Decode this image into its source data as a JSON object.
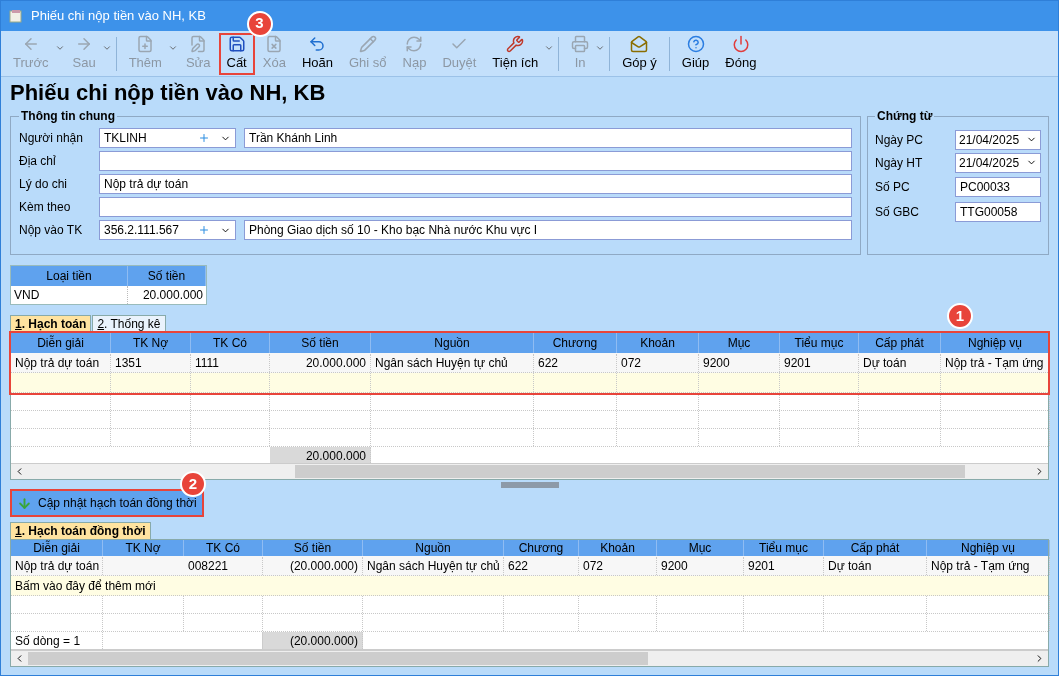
{
  "window": {
    "title": "Phiếu chi nộp tiền vào NH, KB"
  },
  "toolbar": [
    {
      "kind": "button",
      "label": "Trước",
      "disabled": true,
      "dropdown": true
    },
    {
      "kind": "button",
      "label": "Sau",
      "disabled": true,
      "dropdown": true
    },
    {
      "kind": "separator"
    },
    {
      "kind": "button",
      "label": "Thêm",
      "disabled": true,
      "dropdown": true
    },
    {
      "kind": "button",
      "label": "Sửa",
      "disabled": true,
      "dropdown": false
    },
    {
      "kind": "button",
      "label": "Cất",
      "disabled": false,
      "dropdown": false,
      "callout": "3"
    },
    {
      "kind": "button",
      "label": "Xóa",
      "disabled": true,
      "dropdown": false
    },
    {
      "kind": "button",
      "label": "Hoãn",
      "disabled": false,
      "dropdown": false
    },
    {
      "kind": "button",
      "label": "Ghi sổ",
      "disabled": true,
      "dropdown": false
    },
    {
      "kind": "button",
      "label": "Nạp",
      "disabled": true,
      "dropdown": false
    },
    {
      "kind": "button",
      "label": "Duyệt",
      "disabled": true,
      "dropdown": false
    },
    {
      "kind": "button",
      "label": "Tiện ích",
      "disabled": false,
      "dropdown": true
    },
    {
      "kind": "separator"
    },
    {
      "kind": "button",
      "label": "In",
      "disabled": true,
      "dropdown": true
    },
    {
      "kind": "separator"
    },
    {
      "kind": "button",
      "label": "Góp ý",
      "disabled": false,
      "dropdown": false
    },
    {
      "kind": "separator"
    },
    {
      "kind": "button",
      "label": "Giúp",
      "disabled": false,
      "dropdown": false
    },
    {
      "kind": "button",
      "label": "Đóng",
      "disabled": false,
      "dropdown": false
    }
  ],
  "heading": "Phiếu chi nộp tiền vào NH, KB",
  "general_info": {
    "title": "Thông tin chung",
    "fields": [
      {
        "kind": "lookup",
        "label": "Người nhận",
        "value": "TKLINH",
        "detail": "Trần Khánh Linh"
      },
      {
        "kind": "text",
        "label": "Địa chỉ"
      },
      {
        "kind": "text",
        "label": "Lý do chi",
        "value": "Nộp trả dự toán"
      },
      {
        "kind": "text",
        "label": "Kèm theo"
      },
      {
        "kind": "lookup",
        "label": "Nộp vào TK",
        "value": "356.2.111.567",
        "detail": "Phòng Giao dịch số 10 - Kho bạc Nhà nước Khu vực I"
      }
    ]
  },
  "voucher": {
    "title": "Chứng từ",
    "fields": [
      {
        "kind": "date",
        "label": "Ngày PC",
        "value": "21/04/2025"
      },
      {
        "kind": "date",
        "label": "Ngày HT",
        "value": "21/04/2025"
      },
      {
        "kind": "text",
        "label": "Số PC",
        "value": "PC00033"
      },
      {
        "kind": "text",
        "label": "Số GBC",
        "value": "TTG00058"
      }
    ]
  },
  "currency_table": {
    "columns": [
      "Loại tiền",
      "Số tiền"
    ],
    "rows": [
      [
        "VND",
        "20.000.000"
      ]
    ]
  },
  "tabs": [
    {
      "hotkey": "1",
      "label": ". Hạch toán",
      "selected": true
    },
    {
      "hotkey": "2",
      "label": ". Thống kê",
      "selected": false
    }
  ],
  "entries_grid": {
    "callout": "1",
    "columns": [
      "Diễn giải",
      "TK Nợ",
      "TK Có",
      "Số tiền",
      "Nguồn",
      "Chương",
      "Khoản",
      "Mục",
      "Tiểu mục",
      "Cấp phát",
      "Nghiệp vụ"
    ],
    "rows": [
      [
        "Nộp trả dự toán",
        "1351",
        "1111",
        "20.000.000",
        "Ngân sách Huyện tự chủ",
        "622",
        "072",
        "9200",
        "9201",
        "Dự toán",
        "Nộp trả - Tạm ứng"
      ]
    ],
    "total": "20.000.000"
  },
  "update_button": {
    "label": "Cập nhật hạch toán đồng thời",
    "callout": "2"
  },
  "concurrent_tabs": [
    {
      "hotkey": "1",
      "label": ". Hạch toán đồng thời",
      "selected": true
    }
  ],
  "concurrent_grid": {
    "columns": [
      "Diễn giải",
      "TK Nợ",
      "TK Có",
      "Số tiền",
      "Nguồn",
      "Chương",
      "Khoản",
      "Mục",
      "Tiểu mục",
      "Cấp phát",
      "Nghiệp vụ"
    ],
    "rows": [
      [
        "Nộp trả dự toán",
        "",
        "008221",
        "(20.000.000)",
        "Ngân sách Huyện tự chủ",
        "622",
        "072",
        "9200",
        "9201",
        "Dự toán",
        "Nộp trả - Tạm ứng"
      ]
    ],
    "new_row_hint": "Bấm vào đây để thêm mới",
    "row_count": "Số dòng = 1",
    "total": "(20.000.000)"
  }
}
